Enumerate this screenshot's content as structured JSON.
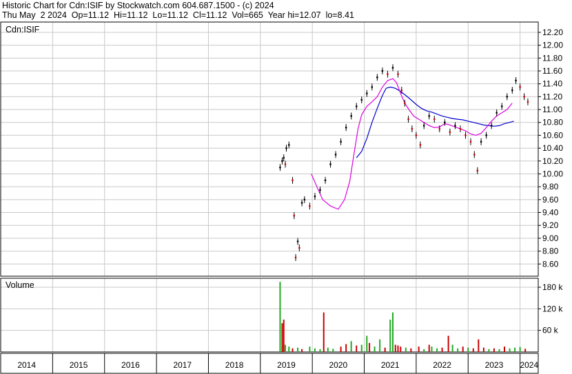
{
  "header": {
    "line1": "Historic Chart for Cdn:ISIF by Stockwatch.com 604.687.1500 - (c) 2024",
    "line2": "Thu May  2 2024  Op=11.12  Hi=11.12  Lo=11.12  Cl=11.12  Vol=665  Year hi=12.07  lo=8.41"
  },
  "chart_data": {
    "type": "line",
    "symbol_label": "Cdn:ISIF",
    "volume_label": "Volume",
    "price_axis": {
      "ylim": [
        8.41,
        12.36
      ],
      "ticks": [
        "12.20",
        "12.00",
        "11.80",
        "11.60",
        "11.40",
        "11.20",
        "11.00",
        "10.80",
        "10.60",
        "10.40",
        "10.20",
        "10.00",
        "9.80",
        "9.60",
        "9.40",
        "9.20",
        "9.00",
        "8.80",
        "8.60"
      ]
    },
    "volume_axis": {
      "ylim": [
        0,
        205000
      ],
      "ticks": [
        {
          "value": 180000,
          "label": "180 k"
        },
        {
          "value": 120000,
          "label": "120 k"
        },
        {
          "value": 60000,
          "label": "60 k"
        }
      ]
    },
    "x_axis": {
      "xlim": [
        2014.0,
        2024.35
      ],
      "years": [
        "2014",
        "2015",
        "2016",
        "2017",
        "2018",
        "2019",
        "2020",
        "2021",
        "2022",
        "2023",
        "2024"
      ]
    },
    "grid": true,
    "colors": {
      "price_up": "#000000",
      "price_down": "#cc0000",
      "ma_short": "#dd00dd",
      "ma_long": "#0000cc",
      "volume_up": "#22aa22",
      "volume_down": "#cc0000",
      "grid": "#c8c8c8"
    },
    "price_points": [
      [
        2019.38,
        10.1
      ],
      [
        2019.42,
        10.2
      ],
      [
        2019.45,
        10.25
      ],
      [
        2019.48,
        10.15
      ],
      [
        2019.5,
        10.4
      ],
      [
        2019.55,
        10.45
      ],
      [
        2019.62,
        9.9
      ],
      [
        2019.65,
        9.35
      ],
      [
        2019.68,
        8.7
      ],
      [
        2019.72,
        8.95
      ],
      [
        2019.75,
        8.85
      ],
      [
        2019.8,
        9.55
      ],
      [
        2019.85,
        9.6
      ],
      [
        2019.95,
        9.5
      ],
      [
        2020.05,
        9.65
      ],
      [
        2020.15,
        9.75
      ],
      [
        2020.25,
        9.9
      ],
      [
        2020.35,
        10.15
      ],
      [
        2020.45,
        10.3
      ],
      [
        2020.55,
        10.5
      ],
      [
        2020.65,
        10.72
      ],
      [
        2020.75,
        10.9
      ],
      [
        2020.85,
        11.05
      ],
      [
        2020.95,
        11.15
      ],
      [
        2021.05,
        11.25
      ],
      [
        2021.15,
        11.35
      ],
      [
        2021.25,
        11.5
      ],
      [
        2021.35,
        11.6
      ],
      [
        2021.45,
        11.55
      ],
      [
        2021.55,
        11.65
      ],
      [
        2021.65,
        11.55
      ],
      [
        2021.72,
        11.3
      ],
      [
        2021.78,
        11.1
      ],
      [
        2021.85,
        10.85
      ],
      [
        2021.92,
        10.7
      ],
      [
        2022.0,
        10.6
      ],
      [
        2022.08,
        10.45
      ],
      [
        2022.15,
        10.75
      ],
      [
        2022.25,
        10.9
      ],
      [
        2022.35,
        10.85
      ],
      [
        2022.45,
        10.7
      ],
      [
        2022.55,
        10.8
      ],
      [
        2022.65,
        10.65
      ],
      [
        2022.75,
        10.75
      ],
      [
        2022.85,
        10.7
      ],
      [
        2022.95,
        10.6
      ],
      [
        2023.05,
        10.5
      ],
      [
        2023.12,
        10.3
      ],
      [
        2023.18,
        10.05
      ],
      [
        2023.25,
        10.5
      ],
      [
        2023.35,
        10.6
      ],
      [
        2023.45,
        10.75
      ],
      [
        2023.55,
        10.95
      ],
      [
        2023.65,
        11.05
      ],
      [
        2023.75,
        11.2
      ],
      [
        2023.85,
        11.3
      ],
      [
        2023.92,
        11.45
      ],
      [
        2024.0,
        11.35
      ],
      [
        2024.08,
        11.2
      ],
      [
        2024.15,
        11.12
      ]
    ],
    "ma_short": [
      [
        2019.98,
        10.0
      ],
      [
        2020.1,
        9.78
      ],
      [
        2020.2,
        9.6
      ],
      [
        2020.35,
        9.5
      ],
      [
        2020.5,
        9.45
      ],
      [
        2020.62,
        9.6
      ],
      [
        2020.72,
        9.88
      ],
      [
        2020.8,
        10.3
      ],
      [
        2020.88,
        10.7
      ],
      [
        2020.95,
        10.92
      ],
      [
        2021.05,
        11.05
      ],
      [
        2021.15,
        11.12
      ],
      [
        2021.25,
        11.2
      ],
      [
        2021.35,
        11.35
      ],
      [
        2021.45,
        11.45
      ],
      [
        2021.55,
        11.48
      ],
      [
        2021.62,
        11.42
      ],
      [
        2021.7,
        11.25
      ],
      [
        2021.78,
        11.1
      ],
      [
        2021.86,
        11.0
      ],
      [
        2021.95,
        10.9
      ],
      [
        2022.05,
        10.85
      ],
      [
        2022.15,
        10.8
      ],
      [
        2022.25,
        10.75
      ],
      [
        2022.35,
        10.72
      ],
      [
        2022.45,
        10.73
      ],
      [
        2022.55,
        10.78
      ],
      [
        2022.65,
        10.76
      ],
      [
        2022.75,
        10.73
      ],
      [
        2022.85,
        10.7
      ],
      [
        2022.95,
        10.67
      ],
      [
        2023.05,
        10.62
      ],
      [
        2023.15,
        10.6
      ],
      [
        2023.25,
        10.63
      ],
      [
        2023.35,
        10.72
      ],
      [
        2023.45,
        10.82
      ],
      [
        2023.55,
        10.9
      ],
      [
        2023.65,
        10.95
      ],
      [
        2023.75,
        11.0
      ],
      [
        2023.85,
        11.1
      ]
    ],
    "ma_long": [
      [
        2020.85,
        10.25
      ],
      [
        2020.95,
        10.35
      ],
      [
        2021.05,
        10.55
      ],
      [
        2021.15,
        10.8
      ],
      [
        2021.25,
        11.02
      ],
      [
        2021.35,
        11.22
      ],
      [
        2021.42,
        11.33
      ],
      [
        2021.5,
        11.35
      ],
      [
        2021.6,
        11.33
      ],
      [
        2021.7,
        11.28
      ],
      [
        2021.8,
        11.22
      ],
      [
        2021.9,
        11.15
      ],
      [
        2022.0,
        11.08
      ],
      [
        2022.1,
        11.02
      ],
      [
        2022.2,
        10.98
      ],
      [
        2022.3,
        10.96
      ],
      [
        2022.4,
        10.93
      ],
      [
        2022.5,
        10.9
      ],
      [
        2022.6,
        10.88
      ],
      [
        2022.7,
        10.86
      ],
      [
        2022.8,
        10.85
      ],
      [
        2022.9,
        10.84
      ],
      [
        2023.0,
        10.82
      ],
      [
        2023.1,
        10.8
      ],
      [
        2023.2,
        10.78
      ],
      [
        2023.3,
        10.76
      ],
      [
        2023.4,
        10.75
      ],
      [
        2023.5,
        10.74
      ],
      [
        2023.6,
        10.75
      ],
      [
        2023.7,
        10.78
      ],
      [
        2023.8,
        10.8
      ],
      [
        2023.88,
        10.82
      ]
    ],
    "volume_bars": [
      [
        2019.38,
        195000,
        "up"
      ],
      [
        2019.42,
        80000,
        "down"
      ],
      [
        2019.45,
        90000,
        "down"
      ],
      [
        2019.48,
        20000,
        "up"
      ],
      [
        2019.55,
        15000,
        "up"
      ],
      [
        2019.62,
        10000,
        "down"
      ],
      [
        2019.72,
        12000,
        "up"
      ],
      [
        2019.8,
        8000,
        "down"
      ],
      [
        2019.95,
        15000,
        "up"
      ],
      [
        2020.05,
        10000,
        "up"
      ],
      [
        2020.15,
        8000,
        "up"
      ],
      [
        2020.22,
        110000,
        "down"
      ],
      [
        2020.3,
        12000,
        "up"
      ],
      [
        2020.4,
        9000,
        "up"
      ],
      [
        2020.55,
        15000,
        "down"
      ],
      [
        2020.65,
        22000,
        "down"
      ],
      [
        2020.75,
        30000,
        "up"
      ],
      [
        2020.85,
        18000,
        "down"
      ],
      [
        2020.95,
        20000,
        "up"
      ],
      [
        2021.05,
        45000,
        "up"
      ],
      [
        2021.1,
        25000,
        "down"
      ],
      [
        2021.2,
        15000,
        "up"
      ],
      [
        2021.3,
        35000,
        "up"
      ],
      [
        2021.4,
        12000,
        "down"
      ],
      [
        2021.5,
        90000,
        "up"
      ],
      [
        2021.55,
        110000,
        "up"
      ],
      [
        2021.6,
        20000,
        "down"
      ],
      [
        2021.65,
        18000,
        "down"
      ],
      [
        2021.7,
        15000,
        "down"
      ],
      [
        2021.8,
        12000,
        "up"
      ],
      [
        2021.9,
        10000,
        "down"
      ],
      [
        2022.05,
        15000,
        "down"
      ],
      [
        2022.15,
        8000,
        "up"
      ],
      [
        2022.25,
        20000,
        "down"
      ],
      [
        2022.3,
        15000,
        "up"
      ],
      [
        2022.4,
        10000,
        "up"
      ],
      [
        2022.5,
        12000,
        "down"
      ],
      [
        2022.62,
        45000,
        "down"
      ],
      [
        2022.7,
        20000,
        "up"
      ],
      [
        2022.8,
        10000,
        "up"
      ],
      [
        2022.9,
        15000,
        "down"
      ],
      [
        2023.0,
        12000,
        "up"
      ],
      [
        2023.1,
        10000,
        "down"
      ],
      [
        2023.2,
        35000,
        "down"
      ],
      [
        2023.3,
        12000,
        "down"
      ],
      [
        2023.4,
        8000,
        "up"
      ],
      [
        2023.5,
        10000,
        "down"
      ],
      [
        2023.6,
        8000,
        "up"
      ],
      [
        2023.7,
        15000,
        "down"
      ],
      [
        2023.8,
        10000,
        "up"
      ],
      [
        2023.9,
        12000,
        "up"
      ],
      [
        2024.0,
        14000,
        "up"
      ],
      [
        2024.1,
        9000,
        "down"
      ]
    ]
  }
}
